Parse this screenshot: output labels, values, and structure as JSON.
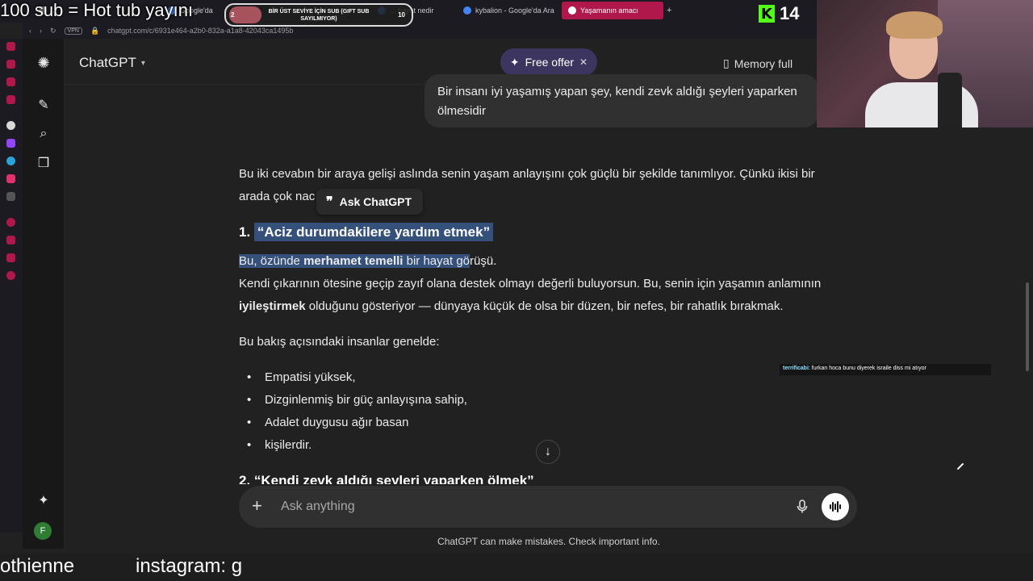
{
  "browser": {
    "tabs": [
      {
        "label": "...",
        "favicon_color": "#9a9a9a"
      },
      {
        "label": "Google'da",
        "favicon_color": "#4285f4"
      },
      {
        "label": "... hayat nedir",
        "favicon_color": "#4285f4"
      },
      {
        "label": "kybalion - Google'da Ara",
        "favicon_color": "#4285f4"
      },
      {
        "label": "Yaşamanın amacı",
        "favicon_color": "#ffffff"
      }
    ],
    "new_tab_icon": "plus-icon",
    "url": "chatgpt.com/c/6931e464-a2b0-832a-a1a8-42043ca1495b",
    "vpn_label": "VPN"
  },
  "header": {
    "model_label": "ChatGPT",
    "free_offer_label": "Free offer",
    "memory_label": "Memory full"
  },
  "chat": {
    "user_message": "Bir insanı iyi yaşamış yapan şey, kendi zevk aldığı şeyleri yaparken ölmesidir",
    "intro_line1": "Bu iki cevabın bir araya gelişi aslında senin yaşam anlayışını çok güçlü bir şekilde tanımlıyor. Çünkü ikisi bir",
    "intro_line2_prefix": "arada çok nac",
    "ask_chatgpt_label": "Ask ChatGPT",
    "heading1_num": "1.",
    "heading1_text": "“Aciz durumdakilere yardım etmek”",
    "p1_hl_a": "Bu, özünde ",
    "p1_hl_bold": "merhamet temelli",
    "p1_hl_b": " bir hayat gö",
    "p1_rest": "rüşü.",
    "p2_line1": "Kendi çıkarının ötesine geçip zayıf olana destek olmayı değerli buluyorsun. Bu, senin için yaşamın anlamının",
    "p2_bold": "iyileştirmek",
    "p2_line2_rest": " olduğunu gösteriyor — dünyaya küçük de olsa bir düzen, bir nefes, bir rahatlık bırakmak.",
    "p3": "Bu bakış açısındaki insanlar genelde:",
    "bullets": [
      "Empatisi yüksek,",
      "Dizginlenmiş bir güç anlayışına sahip,",
      "Adalet duygusu ağır basan",
      "kişilerdir."
    ],
    "heading2": "2. “Kendi zevk aldığı şeyleri yaparken ölmek”"
  },
  "composer": {
    "placeholder": "Ask anything",
    "disclaimer": "ChatGPT can make mistakes. Check important info."
  },
  "sidebar": {
    "avatar_initial": "F"
  },
  "overlays": {
    "top_text": "100 sub = Hot tub yayını",
    "sub_alert_text": "BİR ÜST SEVİYE İÇİN SUB (GIFT SUB SAYILMIYOR)",
    "sub_alert_left": "2",
    "sub_alert_right": "10",
    "kick_count": "14",
    "chat_user": "terrificabi",
    "chat_message": ": furkan hoca bunu diyerek israile diss mi atıyor",
    "bottom_left": "othienne",
    "bottom_right": "instagram: g"
  },
  "colors": {
    "background": "#212121",
    "highlight": "#35507a",
    "offer_bg": "#3b3560",
    "kick_green": "#53fc18",
    "active_tab": "#b0184b"
  }
}
